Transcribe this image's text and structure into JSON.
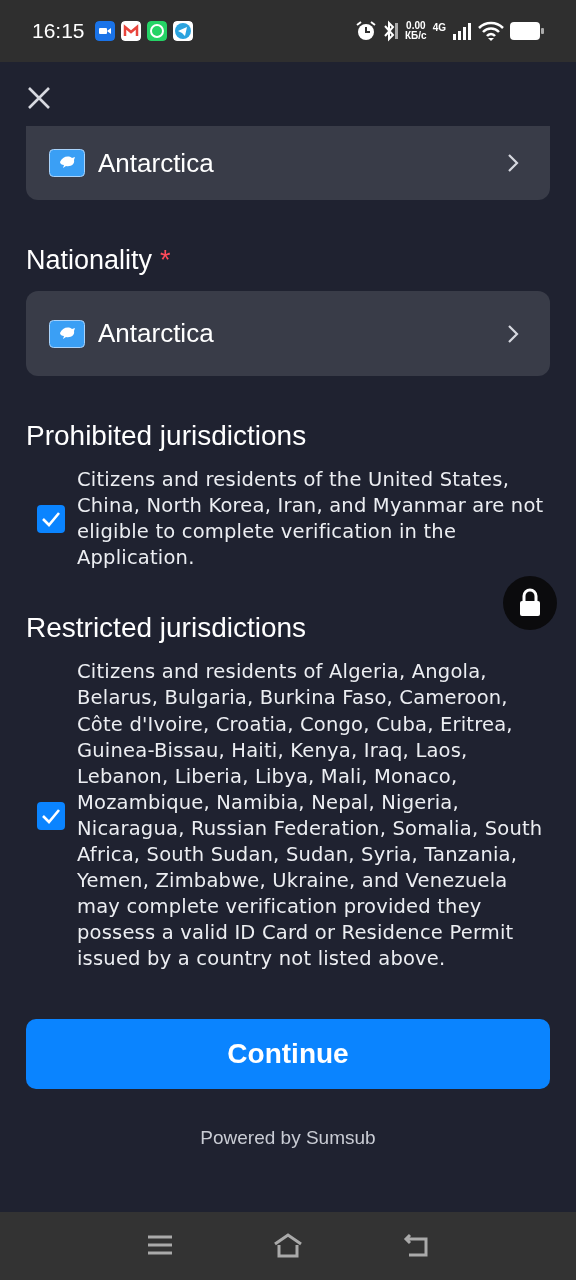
{
  "status_bar": {
    "time": "16:15",
    "net_speed": "0.00",
    "net_unit": "КБ/с",
    "network": "4G"
  },
  "fields": [
    {
      "value": "Antarctica"
    },
    {
      "label": "Nationality",
      "required_mark": "*",
      "value": "Antarctica"
    }
  ],
  "consents": [
    {
      "title": "Prohibited jurisdictions",
      "text": "Citizens and residents of the United States, China, North Korea, Iran, and Myanmar are not eligible to complete verification in the Application.",
      "checked": true
    },
    {
      "title": "Restricted jurisdictions",
      "text": "Citizens and residents of Algeria, Angola, Belarus, Bulgaria, Burkina Faso, Cameroon, Côte d'Ivoire, Croatia, Congo, Cuba, Eritrea, Guinea-Bissau, Haiti, Kenya, Iraq, Laos, Lebanon, Liberia, Libya, Mali, Monaco, Mozambique, Namibia, Nepal, Nigeria, Nicaragua, Russian Federation, Somalia, South Africa, South Sudan, Sudan, Syria, Tanzania, Yemen, Zimbabwe, Ukraine, and Venezuela may complete verification provided they possess a valid ID Card or Residence Permit issued by a country not listed above.",
      "checked": true
    }
  ],
  "continue_button": "Continue",
  "footer": "Powered by Sumsub"
}
